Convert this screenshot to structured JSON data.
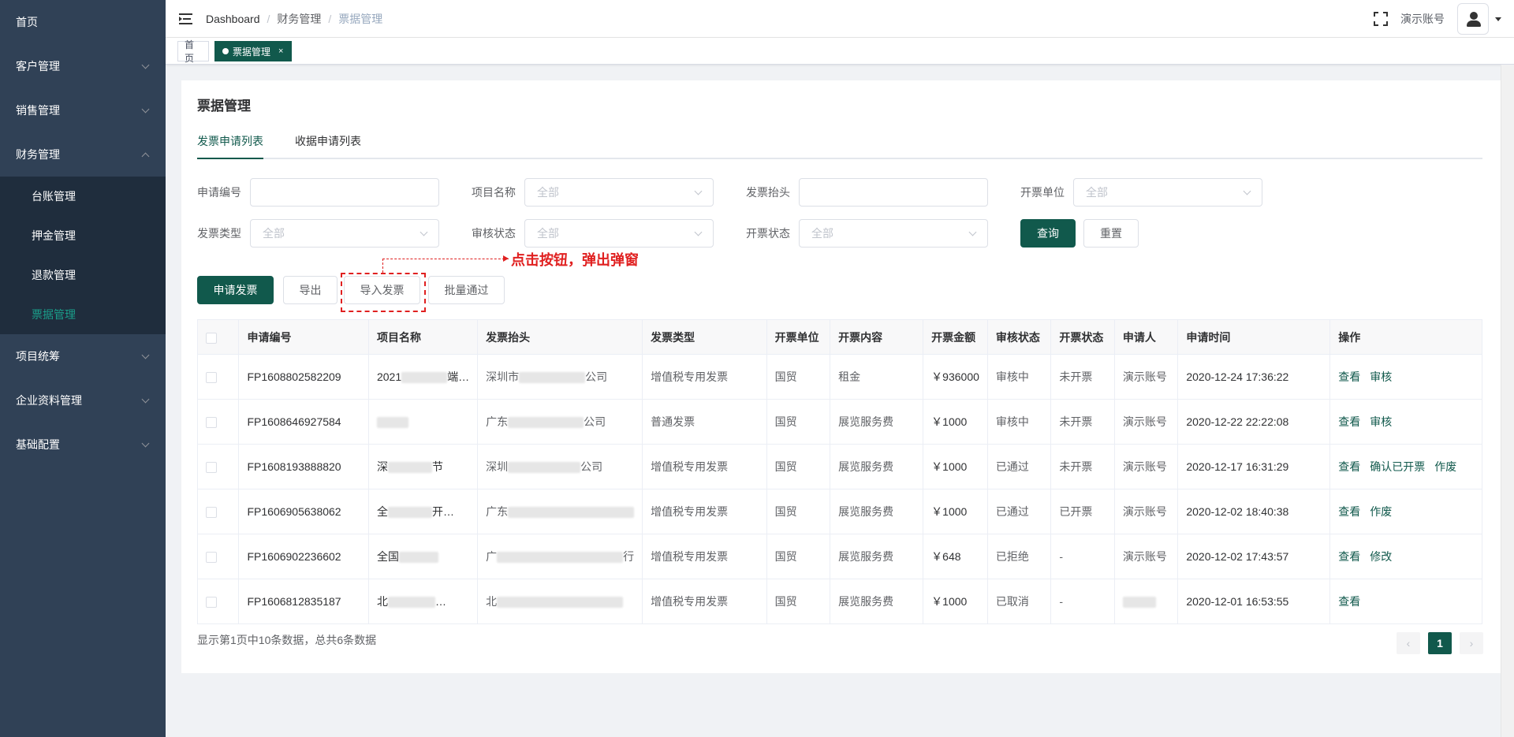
{
  "sidebar": {
    "items": [
      {
        "label": "首页",
        "has_children": false
      },
      {
        "label": "客户管理",
        "has_children": true
      },
      {
        "label": "销售管理",
        "has_children": true
      },
      {
        "label": "财务管理",
        "has_children": true,
        "expanded": true,
        "children": [
          "台账管理",
          "押金管理",
          "退款管理",
          "票据管理"
        ],
        "active_child": "票据管理"
      },
      {
        "label": "项目统筹",
        "has_children": true
      },
      {
        "label": "企业资料管理",
        "has_children": true
      },
      {
        "label": "基础配置",
        "has_children": true
      }
    ]
  },
  "header": {
    "breadcrumb": [
      "Dashboard",
      "财务管理",
      "票据管理"
    ],
    "separator": "/",
    "username": "演示账号"
  },
  "tags": {
    "home": "首页",
    "active": "票据管理",
    "close": "×"
  },
  "page": {
    "title": "票据管理",
    "tabs": [
      "发票申请列表",
      "收据申请列表"
    ],
    "active_tab": "发票申请列表"
  },
  "filters": {
    "application_no": {
      "label": "申请编号",
      "value": ""
    },
    "project_name": {
      "label": "项目名称",
      "placeholder": "全部"
    },
    "invoice_title": {
      "label": "发票抬头",
      "value": ""
    },
    "issuing_unit": {
      "label": "开票单位",
      "placeholder": "全部"
    },
    "invoice_type": {
      "label": "发票类型",
      "placeholder": "全部"
    },
    "review_status": {
      "label": "审核状态",
      "placeholder": "全部"
    },
    "invoice_status": {
      "label": "开票状态",
      "placeholder": "全部"
    },
    "query_button": "查询",
    "reset_button": "重置"
  },
  "toolbar": {
    "apply": "申请发票",
    "export": "导出",
    "import": "导入发票",
    "batch_approve": "批量通过"
  },
  "annotation": {
    "text": "点击按钮，弹出弹窗",
    "color": "#e02020"
  },
  "table": {
    "columns": [
      "申请编号",
      "项目名称",
      "发票抬头",
      "发票类型",
      "开票单位",
      "开票内容",
      "开票金额",
      "审核状态",
      "开票状态",
      "申请人",
      "申请时间",
      "操作"
    ],
    "rows": [
      {
        "no": "FP1608802582209",
        "project": "2021",
        "project_tail": "端…",
        "title": "深圳市",
        "title_tail": "公司",
        "type": "增值税专用发票",
        "unit": "国贸",
        "content": "租金",
        "amount": "￥936000",
        "review": "审核中",
        "status": "未开票",
        "applicant": "演示账号",
        "time": "2020-12-24 17:36:22",
        "actions": [
          "查看",
          "审核"
        ]
      },
      {
        "no": "FP1608646927584",
        "project": "",
        "project_tail": "",
        "title": "广东",
        "title_tail": "公司",
        "type": "普通发票",
        "unit": "国贸",
        "content": "展览服务费",
        "amount": "￥1000",
        "review": "审核中",
        "status": "未开票",
        "applicant": "演示账号",
        "time": "2020-12-22 22:22:08",
        "actions": [
          "查看",
          "审核"
        ]
      },
      {
        "no": "FP1608193888820",
        "project": "深",
        "project_tail": "节",
        "title": "深圳",
        "title_tail": "公司",
        "type": "增值税专用发票",
        "unit": "国贸",
        "content": "展览服务费",
        "amount": "￥1000",
        "review": "已通过",
        "status": "未开票",
        "applicant": "演示账号",
        "time": "2020-12-17 16:31:29",
        "actions": [
          "查看",
          "确认已开票",
          "作废"
        ]
      },
      {
        "no": "FP1606905638062",
        "project": "全",
        "project_tail": "开…",
        "title": "广东",
        "title_tail": "",
        "type": "增值税专用发票",
        "unit": "国贸",
        "content": "展览服务费",
        "amount": "￥1000",
        "review": "已通过",
        "status": "已开票",
        "applicant": "演示账号",
        "time": "2020-12-02 18:40:38",
        "actions": [
          "查看",
          "作废"
        ]
      },
      {
        "no": "FP1606902236602",
        "project": "全国",
        "project_tail": "",
        "title": "广",
        "title_tail": "行",
        "type": "增值税专用发票",
        "unit": "国贸",
        "content": "展览服务费",
        "amount": "￥648",
        "review": "已拒绝",
        "status": "-",
        "applicant": "演示账号",
        "time": "2020-12-02 17:43:57",
        "actions": [
          "查看",
          "修改"
        ]
      },
      {
        "no": "FP1606812835187",
        "project": "北",
        "project_tail": "…",
        "title": "北",
        "title_tail": "",
        "type": "增值税专用发票",
        "unit": "国贸",
        "content": "展览服务费",
        "amount": "￥1000",
        "review": "已取消",
        "status": "-",
        "applicant": "",
        "time": "2020-12-01 16:53:55",
        "actions": [
          "查看"
        ]
      }
    ]
  },
  "footer": {
    "summary": "显示第1页中10条数据，总共6条数据",
    "current_page": "1",
    "prev": "‹",
    "next": "›"
  },
  "colors": {
    "primary": "#11594c",
    "sidebar": "#304156",
    "sidebar_sub": "#1f2d3d"
  }
}
